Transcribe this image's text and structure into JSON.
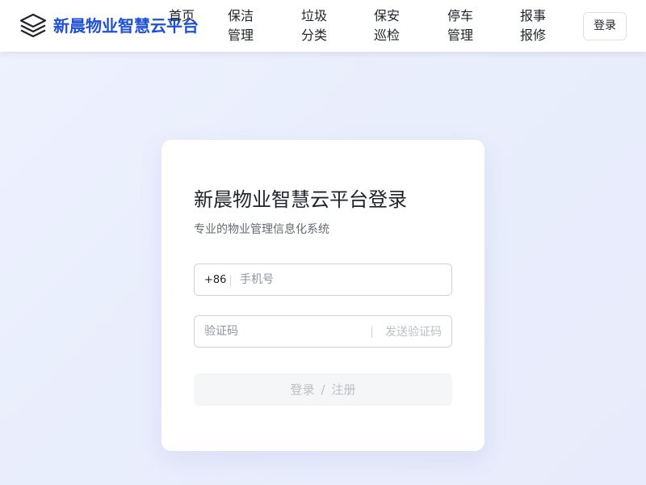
{
  "header": {
    "brand_icon": "layers-icon",
    "brand_title": "新晨物业智慧云平台",
    "brand_color": "#1d4fd8",
    "nav": [
      {
        "id": "home",
        "label": "首页"
      },
      {
        "id": "cleaning",
        "label": "保洁管理"
      },
      {
        "id": "garbage",
        "label": "垃圾分类"
      },
      {
        "id": "security",
        "label": "保安巡检"
      },
      {
        "id": "parking",
        "label": "停车管理"
      },
      {
        "id": "repair",
        "label": "报事报修"
      }
    ],
    "login_label": "登录"
  },
  "login_card": {
    "title": "新晨物业智慧云平台登录",
    "subtitle": "专业的物业管理信息化系统",
    "phone": {
      "country_code": "+86",
      "placeholder": "手机号",
      "value": ""
    },
    "code": {
      "placeholder": "验证码",
      "value": "",
      "send_label": "发送验证码"
    },
    "submit": {
      "login_label": "登录",
      "separator": "/",
      "register_label": "注册"
    }
  }
}
